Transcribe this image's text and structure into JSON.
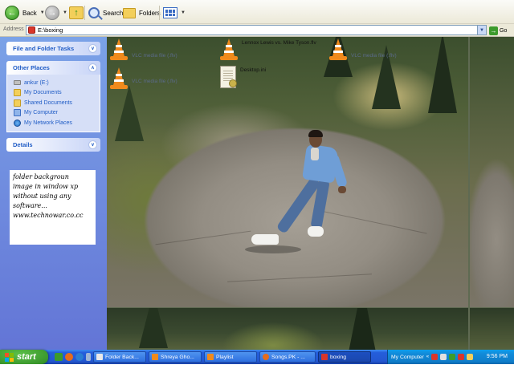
{
  "toolbar": {
    "back_label": "Back",
    "search_label": "Search",
    "folders_label": "Folders"
  },
  "address": {
    "label": "Address",
    "path": "E:\\boxing",
    "go_label": "Go"
  },
  "sidebar": {
    "file_folder_tasks": "File and Folder Tasks",
    "other_places": {
      "title": "Other Places",
      "items": [
        {
          "label": "ankur (E:)",
          "icon": "drive-icon"
        },
        {
          "label": "My Documents",
          "icon": "my-documents-icon"
        },
        {
          "label": "Shared Documents",
          "icon": "shared-documents-icon"
        },
        {
          "label": "My Computer",
          "icon": "my-computer-icon"
        },
        {
          "label": "My Network Places",
          "icon": "network-places-icon"
        }
      ]
    },
    "details": "Details"
  },
  "note": {
    "lines": [
      "folder backgroun",
      "image in window xp",
      "without using any",
      "software...",
      "www.technowar.co.cc"
    ]
  },
  "files": [
    {
      "name": "",
      "type": "VLC media file (.flv)",
      "icon": "vlc-cone-icon"
    },
    {
      "name": "Lennox Lewis vs. Mike Tyson.flv",
      "type": "",
      "icon": "vlc-cone-icon"
    },
    {
      "name": "",
      "type": "VLC media file (.flv)",
      "icon": "vlc-cone-icon"
    },
    {
      "name": "",
      "type": "VLC media file (.flv)",
      "icon": "vlc-cone-icon"
    },
    {
      "name": "Desktop.ini",
      "type": "",
      "icon": "settings-file-icon"
    }
  ],
  "taskbar": {
    "start_label": "start",
    "tasks": [
      {
        "label": "Folder Back...",
        "icon": "document-icon",
        "active": false
      },
      {
        "label": "Shreya Gho...",
        "icon": "vlc-cone-icon",
        "active": false
      },
      {
        "label": "Playlist",
        "icon": "vlc-cone-icon",
        "active": false
      },
      {
        "label": "Songs.PK - ...",
        "icon": "browser-icon",
        "active": false
      },
      {
        "label": "boxing",
        "icon": "folder-icon",
        "active": true
      }
    ],
    "tray_label": "My Computer",
    "clock": "9:56 PM"
  },
  "colors": {
    "taskbar_blue": "#245edb",
    "start_green": "#2f8a22",
    "tray_blue": "#0f7ecb",
    "sidebar_blue": "#6375d6",
    "vlc_orange": "#f08a1c"
  }
}
